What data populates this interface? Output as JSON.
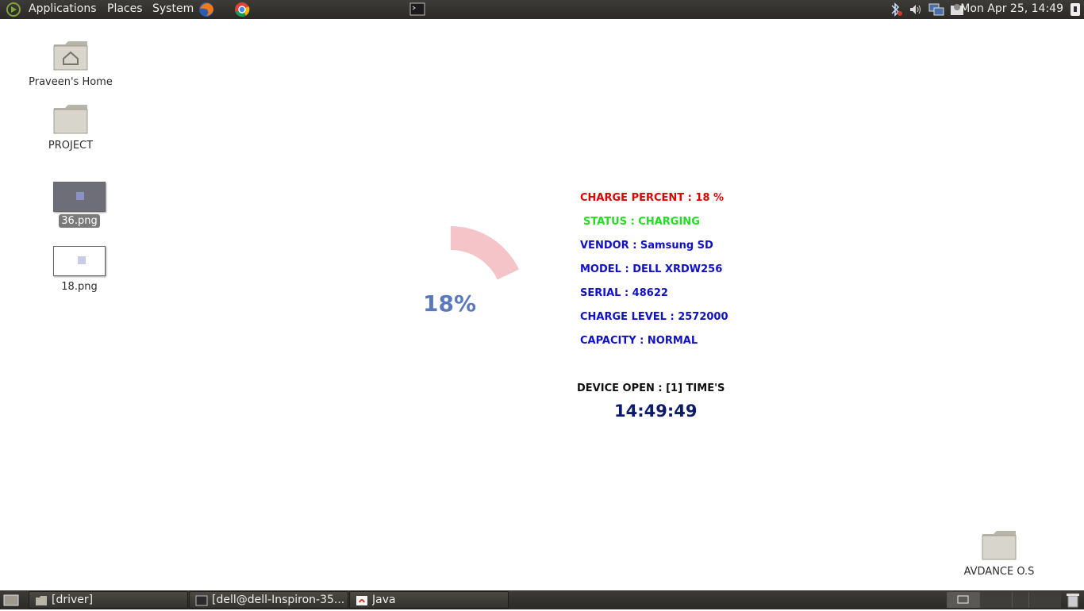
{
  "top_panel": {
    "menus": [
      "Applications",
      "Places",
      "System"
    ],
    "clock": "Mon Apr 25, 14:49"
  },
  "desktop_icons": [
    {
      "label": "Praveen's Home",
      "icon": "home-folder-icon"
    },
    {
      "label": "PROJECT",
      "icon": "folder-icon"
    },
    {
      "label": "36.png",
      "icon": "image-thumbnail"
    },
    {
      "label": "18.png",
      "icon": "image-thumbnail"
    },
    {
      "label": "AVDANCE O.S",
      "icon": "folder-icon"
    }
  ],
  "battery_app": {
    "gauge": {
      "percent_text": "18%",
      "level": 0.18,
      "color": "#f4c4c8"
    },
    "info": {
      "charge_percent": "CHARGE PERCENT : 18 %",
      "status": "STATUS : CHARGING",
      "vendor": "VENDOR : Samsung SD",
      "model": "MODEL : DELL XRDW256",
      "serial": "SERIAL : 48622",
      "charge_level": "CHARGE LEVEL : 2572000",
      "capacity": "CAPACITY : NORMAL",
      "device_open": "DEVICE OPEN : [1] TIME'S"
    },
    "time": "14:49:49"
  },
  "taskbar": {
    "tasks": [
      "[driver]",
      "[dell@dell-Inspiron-35...",
      "Java"
    ]
  },
  "colors": {
    "panel": "#3c3b37",
    "charge_red": "#e00000",
    "status_green": "#22dd22",
    "info_blue": "#1010c8",
    "gauge_text": "#5a79bd"
  }
}
